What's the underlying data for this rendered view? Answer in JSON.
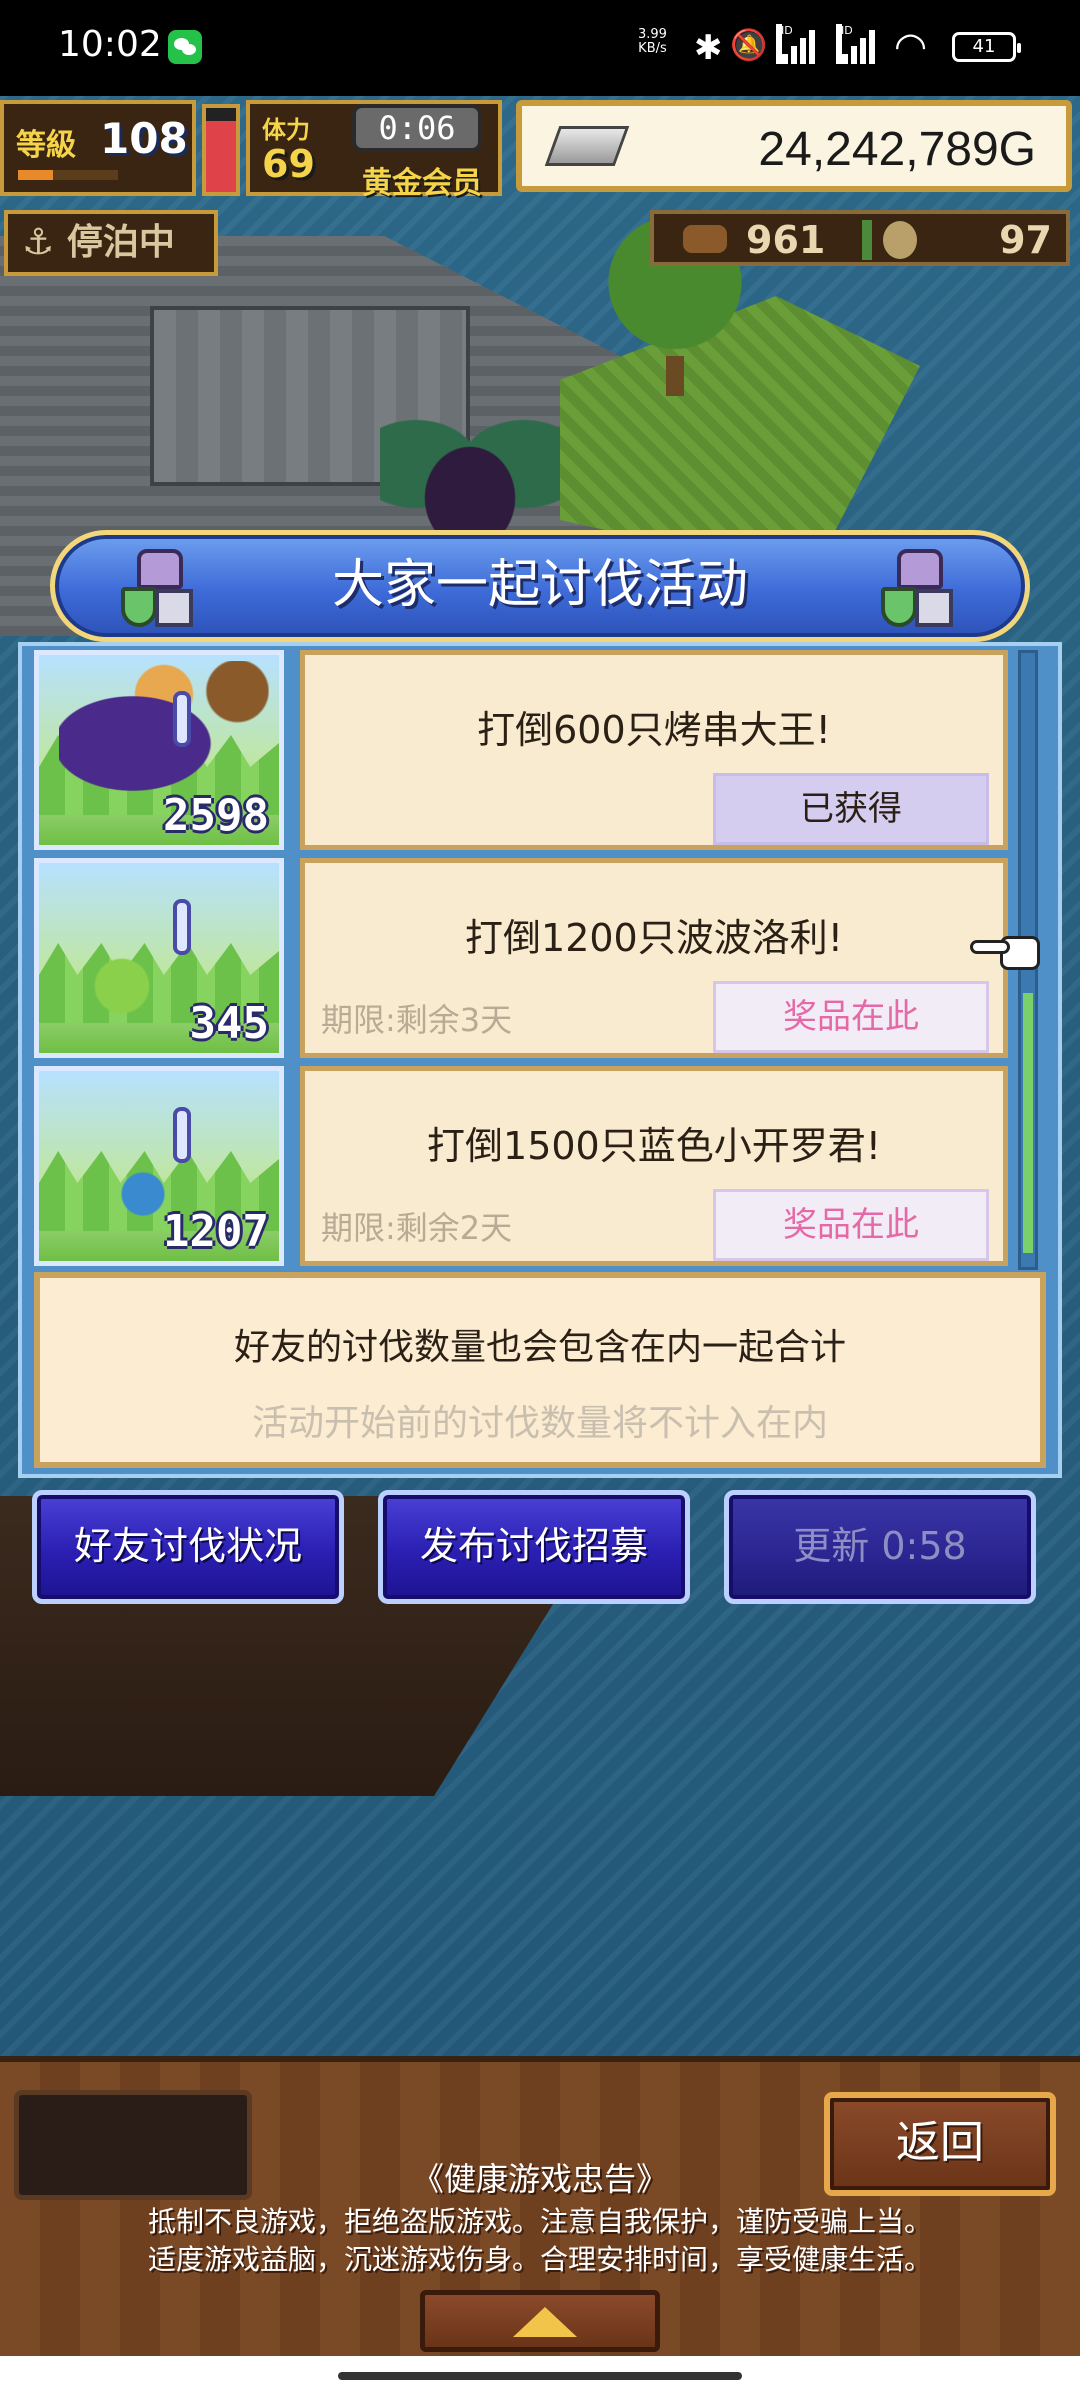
{
  "status_bar": {
    "time": "10:02",
    "net_speed_value": "3.99",
    "net_speed_unit": "KB/s",
    "signal1_label": "HD",
    "signal2_label": "HD",
    "battery": "41",
    "icons": [
      "wechat-icon",
      "bluetooth-icon",
      "mute-icon",
      "signal-icon",
      "wifi-icon",
      "battery-icon"
    ]
  },
  "hud": {
    "level_label": "等級",
    "level_value": "108",
    "exp_progress": 0.35,
    "stamina_level": 0.85,
    "stamina_label": "体力",
    "stamina_value": "69",
    "timer": "0:06",
    "membership": "黄金会员",
    "gold": "24,242,789G",
    "dock_status": "停泊中",
    "resource_wood": "961",
    "resource_coin": "97"
  },
  "dialog": {
    "title": "大家一起讨伐活动",
    "events": [
      {
        "name": "打倒600只烤串大王!",
        "count": "2598",
        "deadline": "",
        "button": "已获得",
        "obtained": true
      },
      {
        "name": "打倒1200只波波洛利!",
        "count": "345",
        "deadline": "期限:剩余3天",
        "button": "奖品在此",
        "obtained": false
      },
      {
        "name": "打倒1500只蓝色小开罗君!",
        "count": "1207",
        "deadline": "期限:剩余2天",
        "button": "奖品在此",
        "obtained": false
      }
    ],
    "note_main": "好友的讨伐数量也会包含在内一起合计",
    "note_sub": "活动开始前的讨伐数量将不计入在内"
  },
  "actions": {
    "friend_status": "好友讨伐状况",
    "publish_recruit": "发布讨伐招募",
    "refresh": "更新 0:58"
  },
  "bottom": {
    "back": "返回",
    "health_title": "《健康游戏忠告》",
    "health_line1": "抵制不良游戏，拒绝盗版游戏。注意自我保护，谨防受骗上当。",
    "health_line2": "适度游戏益脑，沉迷游戏伤身。合理安排时间，享受健康生活。"
  },
  "colors": {
    "dialog_blue": "#3e6bd8",
    "card_bg": "#f8ebcf",
    "reward_pink": "#e569a6",
    "action_button": "#2b1fb3"
  }
}
